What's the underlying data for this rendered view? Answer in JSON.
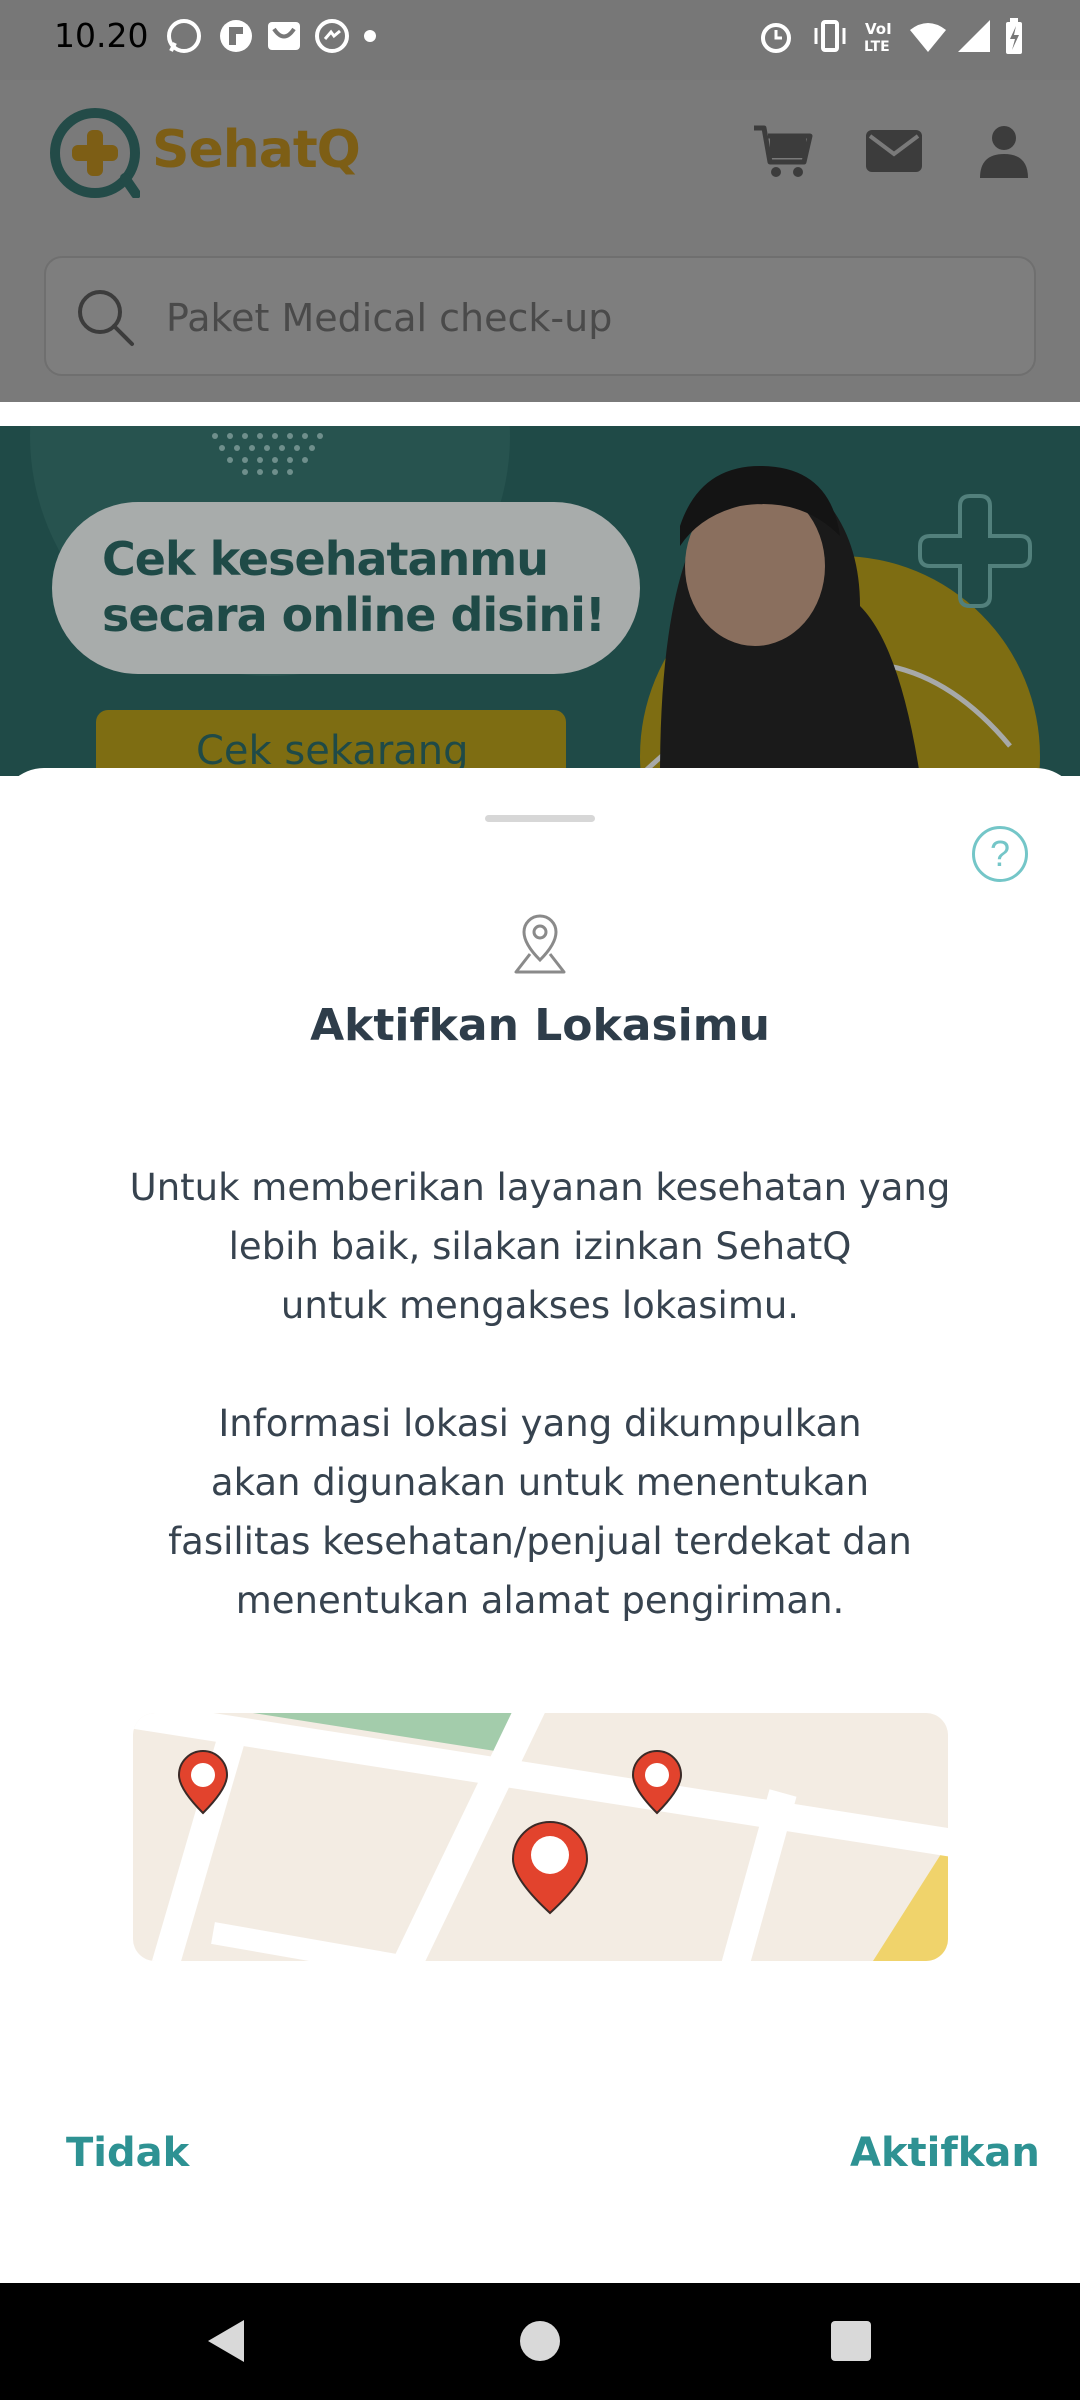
{
  "status_bar": {
    "time": "10.20",
    "left_icons": [
      "whatsapp-icon",
      "flipboard-icon",
      "gmail-icon",
      "messenger-icon",
      "dot-icon"
    ],
    "right_icons": [
      "alarm-icon",
      "vibrate-icon",
      "volte-icon",
      "wifi-icon",
      "signal-icon",
      "battery-charging-icon"
    ]
  },
  "header": {
    "brand": "SehatQ",
    "icons": [
      "cart-icon",
      "mail-icon",
      "profile-icon"
    ]
  },
  "search": {
    "placeholder": "Paket Medical check-up"
  },
  "banner": {
    "line1": "Cek kesehatanmu",
    "line2": "secara online disini!",
    "cta": "Cek sekarang"
  },
  "sheet": {
    "title": "Aktifkan Lokasimu",
    "paragraph1": "Untuk memberikan layanan kesehatan yang\nlebih baik, silakan izinkan SehatQ\nuntuk mengakses lokasimu.",
    "paragraph2": "Informasi lokasi yang dikumpulkan\nakan digunakan untuk menentukan\nfasilitas kesehatan/penjual terdekat dan\nmenentukan alamat pengiriman.",
    "help_icon": "question-circle-icon",
    "location_icon": "location-pin-icon",
    "cancel_label": "Tidak",
    "confirm_label": "Aktifkan"
  },
  "colors": {
    "accent": "#2e9293",
    "overlay": "#777777",
    "map_pin": "#e2432d"
  },
  "nav_bar": {
    "icons": [
      "back-icon",
      "home-icon",
      "recents-icon"
    ]
  }
}
